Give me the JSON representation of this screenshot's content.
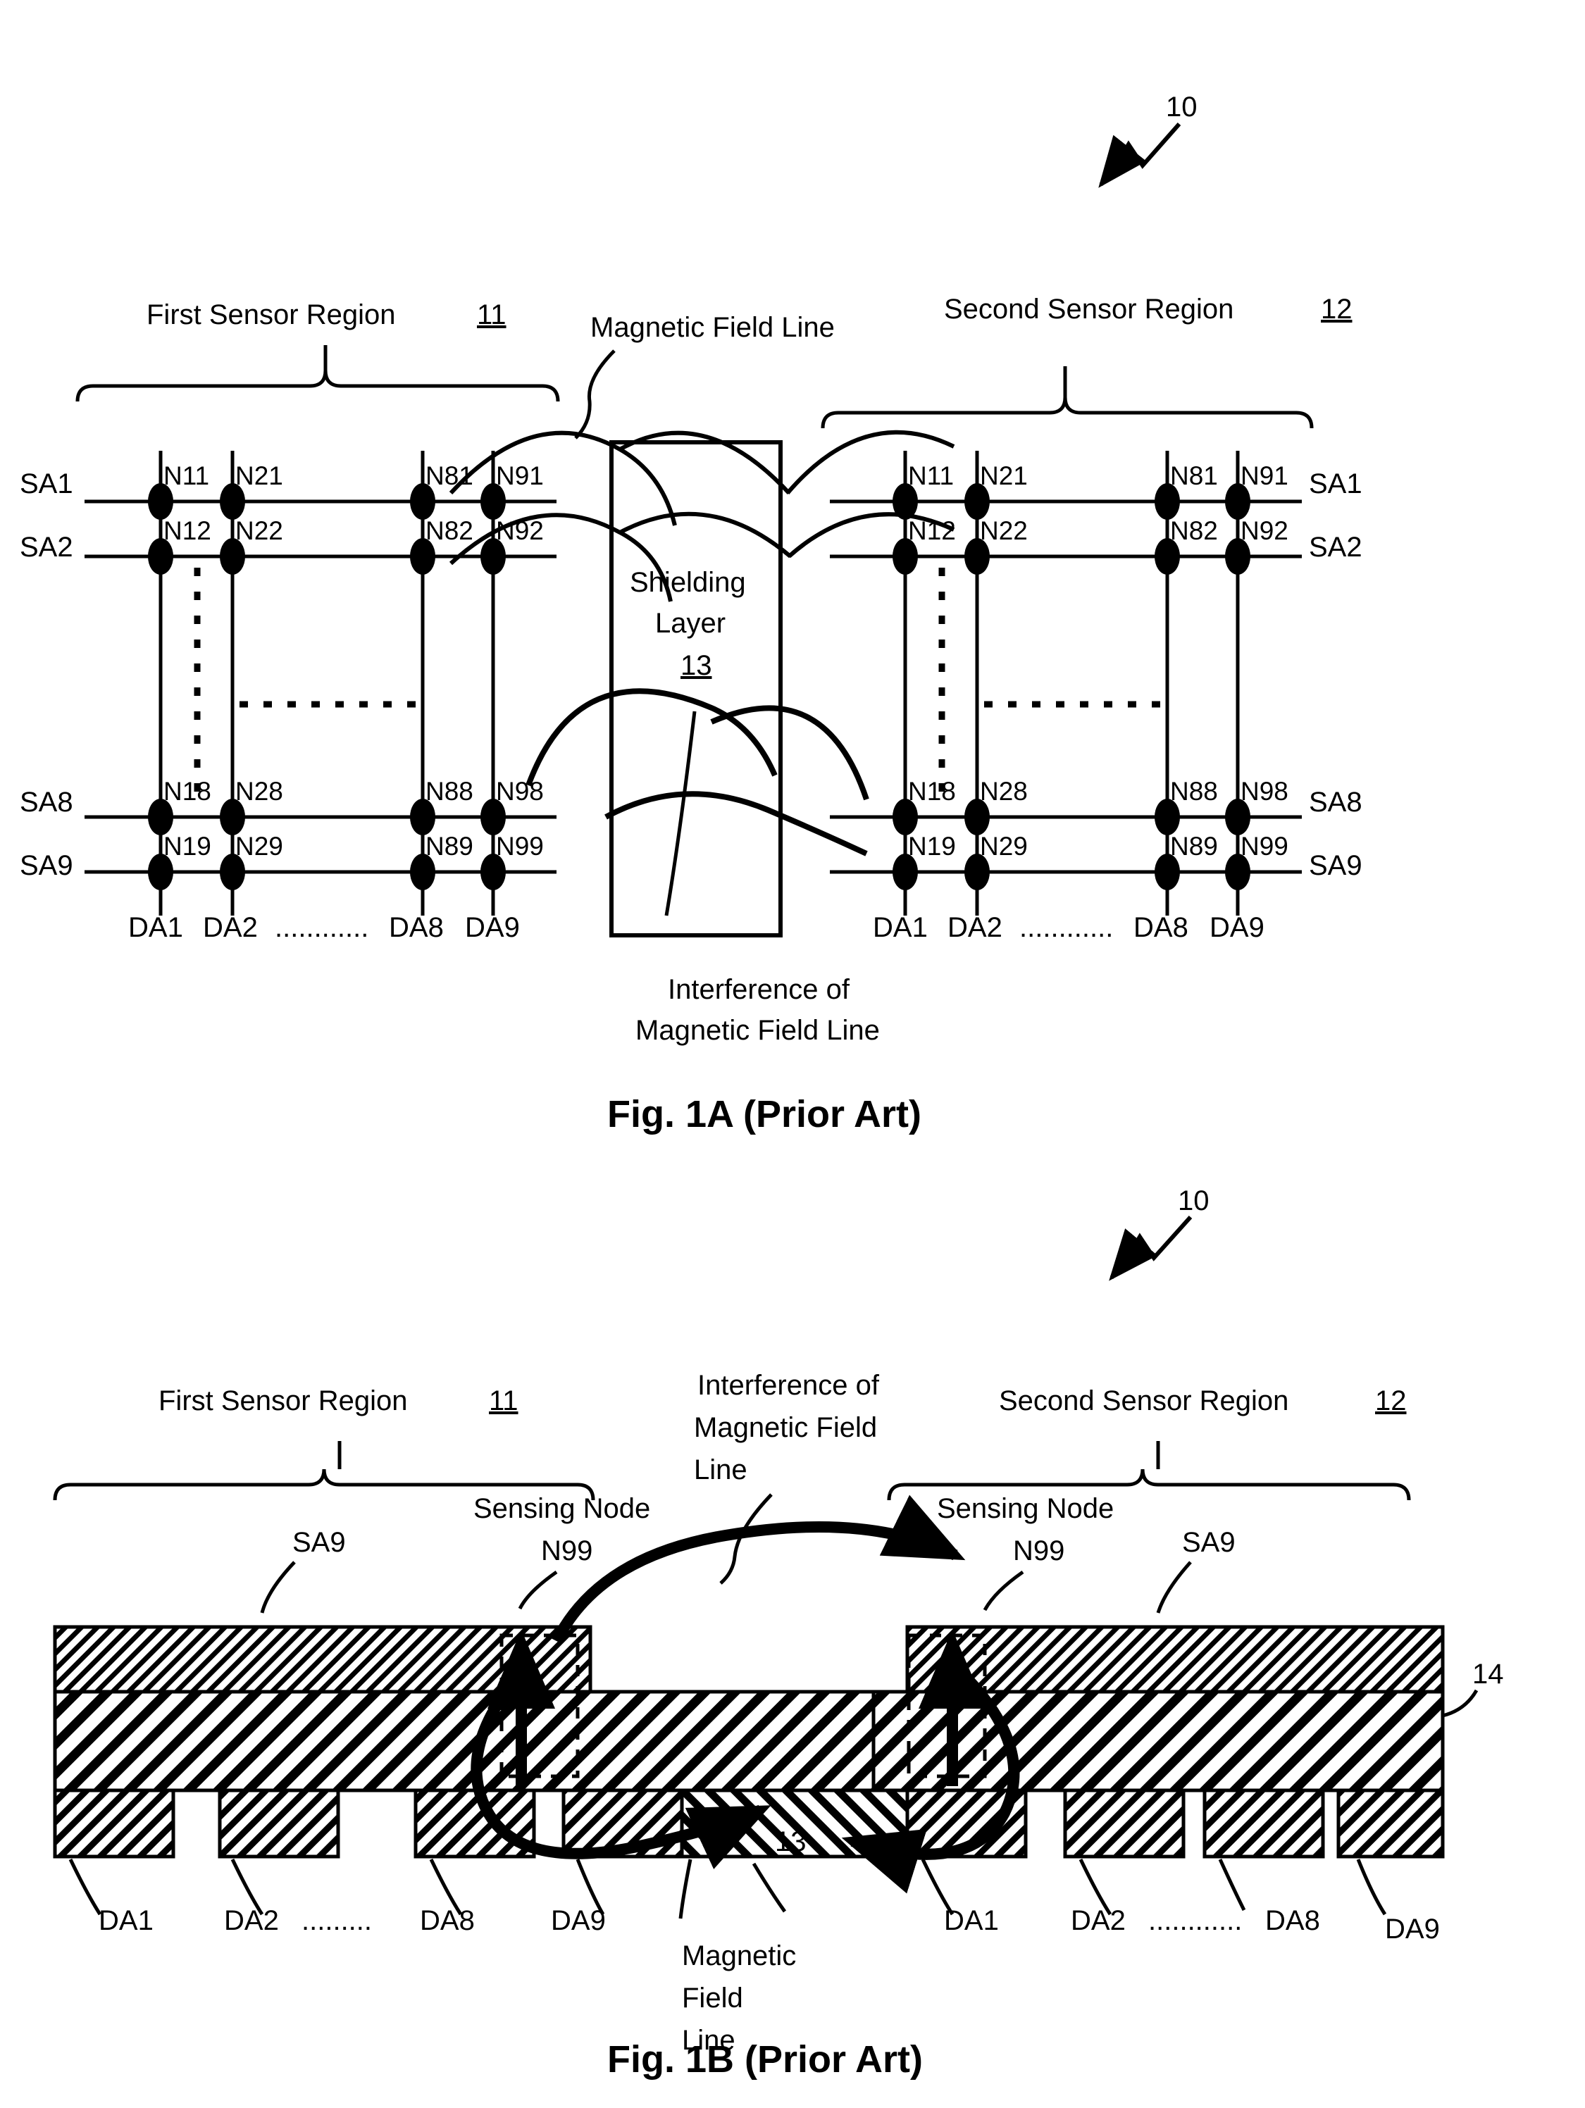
{
  "document": {
    "type": "patent-figure-sheet",
    "figures": [
      "Fig. 1A (Prior Art)",
      "Fig. 1B (Prior Art)"
    ]
  },
  "fig1a": {
    "caption": "Fig. 1A (Prior Art)",
    "device_ref": "10",
    "first_region": {
      "label": "First Sensor Region",
      "ref": "11"
    },
    "second_region": {
      "label": "Second Sensor Region",
      "ref": "12"
    },
    "shield": {
      "line1": "Shielding",
      "line2": "Layer",
      "ref": "13"
    },
    "magnetic_field_label": "Magnetic Field Line",
    "interference_label": {
      "line1": "Interference of",
      "line2": "Magnetic Field Line"
    },
    "sense_lines_left": [
      "SA1",
      "SA2",
      "SA8",
      "SA9"
    ],
    "sense_lines_right": [
      "SA1",
      "SA2",
      "SA8",
      "SA9"
    ],
    "data_lines": [
      "DA1",
      "DA2",
      "DA8",
      "DA9"
    ],
    "data_line_ellipsis": "............",
    "nodes": {
      "row1": [
        "N11",
        "N21",
        "N81",
        "N91"
      ],
      "row2": [
        "N12",
        "N22",
        "N82",
        "N92"
      ],
      "row3": [
        "N18",
        "N28",
        "N88",
        "N98"
      ],
      "row4": [
        "N19",
        "N29",
        "N89",
        "N99"
      ]
    }
  },
  "fig1b": {
    "caption": "Fig. 1B (Prior Art)",
    "device_ref": "10",
    "first_region": {
      "label": "First Sensor Region",
      "ref": "11"
    },
    "second_region": {
      "label": "Second Sensor Region",
      "ref": "12"
    },
    "interference_label": {
      "line1": "Interference of",
      "line2": "Magnetic Field",
      "line3": "Line"
    },
    "magnetic_field_label": {
      "line1": "Magnetic",
      "line2": "Field",
      "line3": "Line"
    },
    "sensing_node_left": {
      "line1": "Sensing Node",
      "line2": "N99"
    },
    "sensing_node_right": {
      "line1": "Sensing Node",
      "line2": "N99"
    },
    "sa9_left": "SA9",
    "sa9_right": "SA9",
    "shield_ref": "13",
    "substrate_ref": "14",
    "data_lines_left": [
      "DA1",
      "DA2",
      "DA8",
      "DA9"
    ],
    "data_lines_right": [
      "DA1",
      "DA2",
      "DA8",
      "DA9"
    ],
    "ellipsis_left": ".........",
    "ellipsis_right": "............"
  },
  "colors": {
    "ink": "#000000",
    "paper": "#ffffff"
  }
}
